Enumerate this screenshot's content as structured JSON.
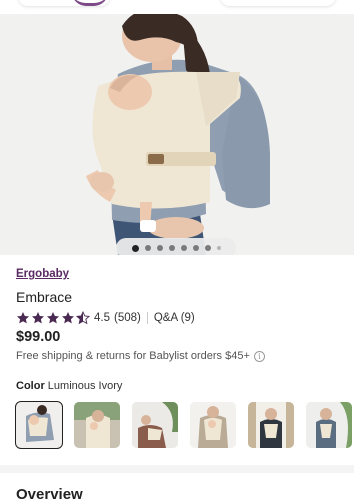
{
  "brand": "Ergobaby",
  "product_title": "Embrace",
  "rating": {
    "stars_filled": 4.5,
    "stars_total": 5,
    "value": "4.5",
    "count": "(508)",
    "qa": "Q&A (9)"
  },
  "price": "$99.00",
  "shipping": "Free shipping & returns for Babylist orders $45+",
  "color": {
    "label": "Color",
    "value": "Luminous Ivory"
  },
  "carousel": {
    "total_dots": 8,
    "active_index": 0
  },
  "thumbnails": [
    "thumb-1",
    "thumb-2",
    "thumb-3",
    "thumb-4",
    "thumb-5",
    "thumb-6"
  ],
  "section_title": "Overview",
  "colors": {
    "accent": "#5a2a63",
    "star": "#4a2a52",
    "carrier": "#efe6d4",
    "shirt": "#8f9eb0"
  }
}
